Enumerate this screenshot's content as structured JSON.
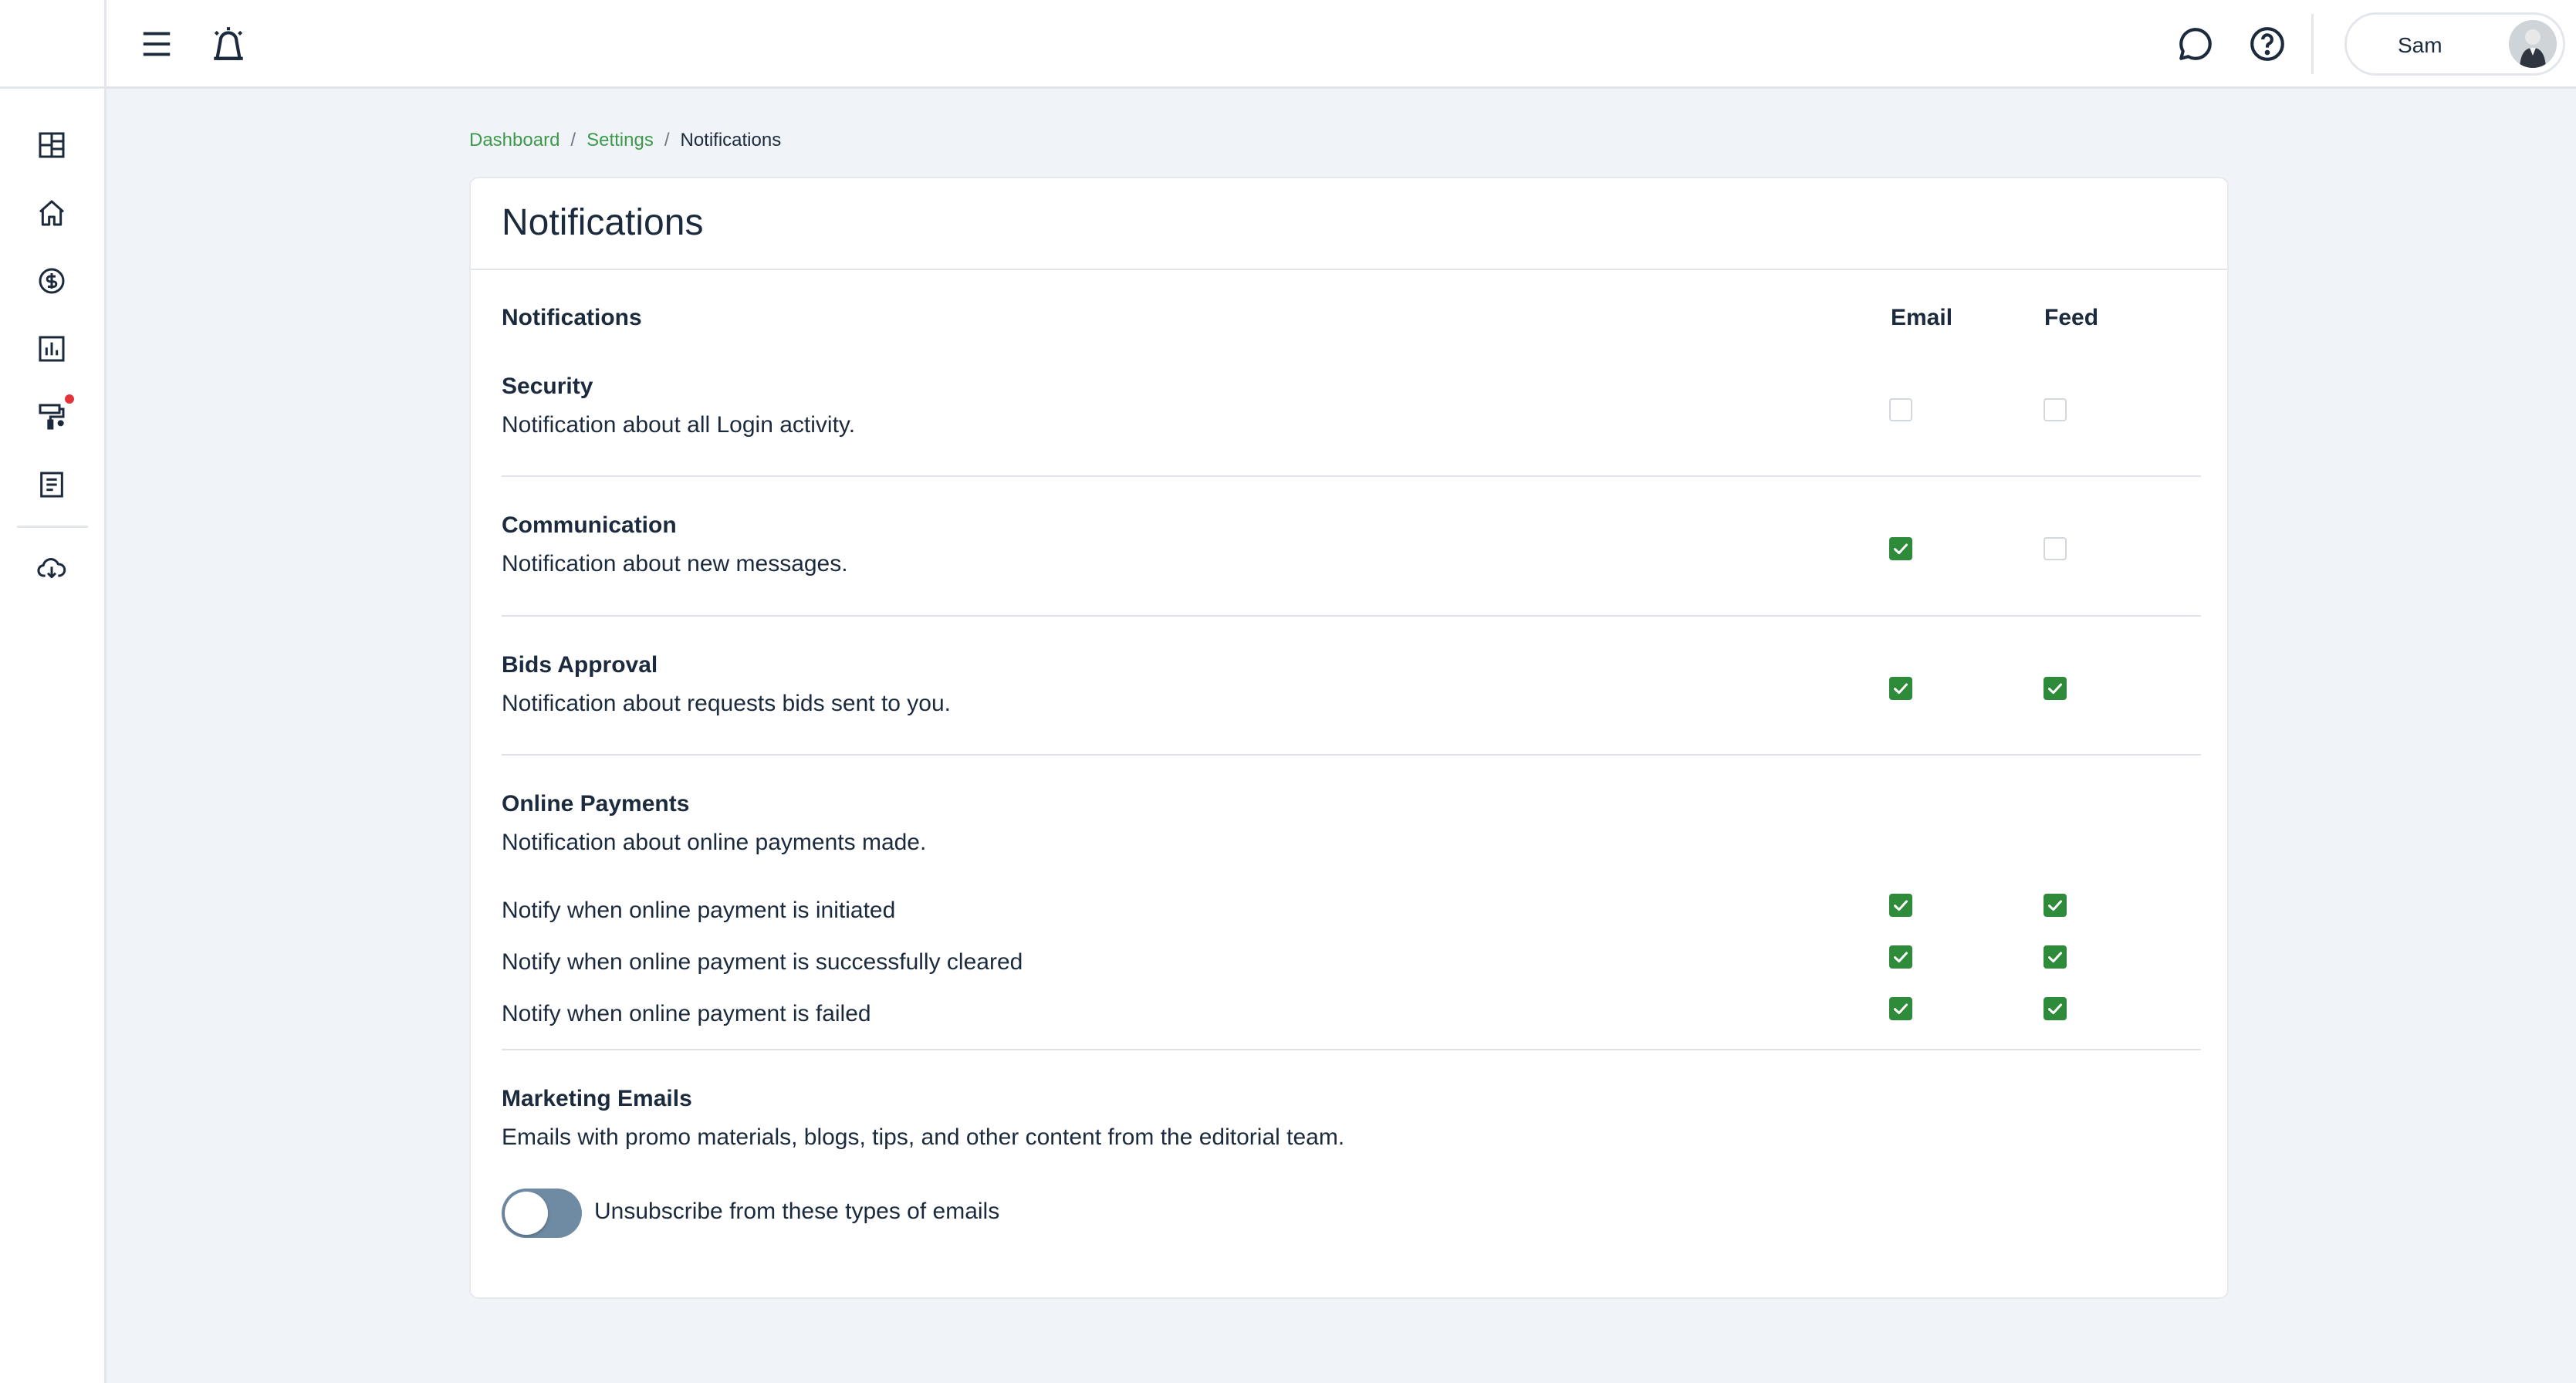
{
  "user": {
    "name": "Sam"
  },
  "breadcrumb": {
    "items": [
      "Dashboard",
      "Settings"
    ],
    "current": "Notifications",
    "separator": "/"
  },
  "page": {
    "title": "Notifications"
  },
  "table": {
    "header": {
      "label": "Notifications",
      "email": "Email",
      "feed": "Feed"
    },
    "sections": [
      {
        "title": "Security",
        "description": "Notification about all Login activity.",
        "email": false,
        "feed": false
      },
      {
        "title": "Communication",
        "description": "Notification about new messages.",
        "email": true,
        "feed": false
      },
      {
        "title": "Bids Approval",
        "description": "Notification about requests bids sent to you.",
        "email": true,
        "feed": true
      },
      {
        "title": "Online Payments",
        "description": "Notification about online payments made.",
        "items": [
          {
            "label": "Notify when online payment is initiated",
            "email": true,
            "feed": true
          },
          {
            "label": "Notify when online payment is successfully cleared",
            "email": true,
            "feed": true
          },
          {
            "label": "Notify when online payment is failed",
            "email": true,
            "feed": true
          }
        ]
      }
    ]
  },
  "marketing": {
    "title": "Marketing Emails",
    "description": "Emails with promo materials, blogs, tips, and other content from the editorial team.",
    "toggle_label": "Unsubscribe from these types of emails",
    "unsubscribed": false
  },
  "sidebar": {
    "icons": [
      "dashboard-icon",
      "home-icon",
      "dollar-icon",
      "chart-icon",
      "paint-roller-icon",
      "document-icon",
      "cloud-download-icon"
    ],
    "badge_color": "#e3343b"
  },
  "colors": {
    "accent": "#3d9a4a",
    "checkbox": "#2e8b3a",
    "toggle": "#6f8ba3"
  }
}
